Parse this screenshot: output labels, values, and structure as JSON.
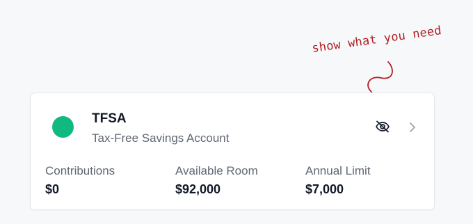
{
  "annotation": {
    "text": "show what you need",
    "color": "#b11f24"
  },
  "account": {
    "title": "TFSA",
    "subtitle": "Tax-Free Savings Account",
    "dot_color": "#10b981",
    "toggle_icon": "eye-off-icon",
    "chevron_icon": "chevron-right-icon"
  },
  "stats": [
    {
      "label": "Contributions",
      "value": "$0"
    },
    {
      "label": "Available Room",
      "value": "$92,000"
    },
    {
      "label": "Annual Limit",
      "value": "$7,000"
    }
  ]
}
